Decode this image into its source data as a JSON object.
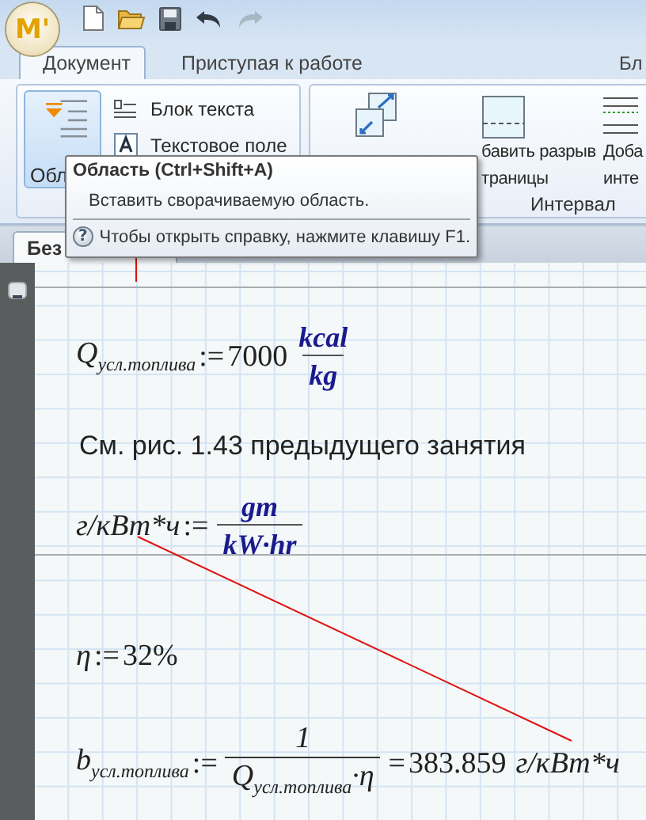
{
  "title_bar": {
    "logo": "M'"
  },
  "ribbon": {
    "tabs": [
      {
        "label": "Документ",
        "selected": true
      },
      {
        "label": "Приступая к работе",
        "selected": false
      },
      {
        "label": "Бл",
        "selected": false
      }
    ],
    "region_button": {
      "label": "Обл",
      "highlighted": true
    },
    "text_buttons": [
      {
        "kind": "text_block",
        "label": "Блок текста"
      },
      {
        "kind": "text_box",
        "label": "Текстовое поле"
      }
    ],
    "interval_group": {
      "label": "Интервал",
      "buttons": [
        {
          "kind": "split"
        },
        {
          "kind": "page_break",
          "lines": [
            "бавить разрыв",
            "траницы"
          ]
        },
        {
          "kind": "spacing",
          "lines": [
            "Доба",
            "инте"
          ]
        }
      ]
    }
  },
  "tooltip": {
    "title": "Область (Ctrl+Shift+A)",
    "description": "Вставить сворачиваемую область.",
    "help_glyph": "?",
    "help": "Чтобы открыть справку, нажмите клавишу F1."
  },
  "document_tabs": [
    {
      "label": "Без",
      "selected": true
    }
  ],
  "worksheet": {
    "area_expanded": true,
    "regions": [
      {
        "kind": "math",
        "lhs": "Q$_{усл.топлива}$",
        "operator": ":=",
        "value": "7000",
        "unit": {
          "numerator": "kcal",
          "denominator": "kg"
        }
      },
      {
        "kind": "text",
        "text": "См. рис. 1.43 предыдущего занятия"
      },
      {
        "kind": "math",
        "lhs": "г/кВт*ч",
        "operator": ":=",
        "unit": {
          "numerator": "gm",
          "denominator": "kW·hr"
        }
      },
      {
        "kind": "math",
        "lhs": "η",
        "operator": ":=",
        "value": "32%"
      },
      {
        "kind": "math",
        "lhs": "b$_{усл.топлива}$",
        "operator": ":=",
        "fraction": {
          "numerator": "1",
          "denominator": "Q$_{усл.топлива}$·η"
        },
        "equals": "=",
        "result": "383.859",
        "result_unit": "г/кВт*ч"
      }
    ]
  }
}
